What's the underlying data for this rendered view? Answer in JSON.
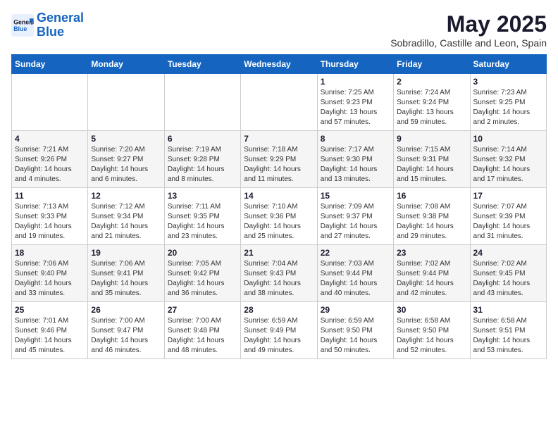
{
  "header": {
    "logo_line1": "General",
    "logo_line2": "Blue",
    "title": "May 2025",
    "subtitle": "Sobradillo, Castille and Leon, Spain"
  },
  "weekdays": [
    "Sunday",
    "Monday",
    "Tuesday",
    "Wednesday",
    "Thursday",
    "Friday",
    "Saturday"
  ],
  "weeks": [
    [
      {
        "day": "",
        "info": ""
      },
      {
        "day": "",
        "info": ""
      },
      {
        "day": "",
        "info": ""
      },
      {
        "day": "",
        "info": ""
      },
      {
        "day": "1",
        "info": "Sunrise: 7:25 AM\nSunset: 9:23 PM\nDaylight: 13 hours\nand 57 minutes."
      },
      {
        "day": "2",
        "info": "Sunrise: 7:24 AM\nSunset: 9:24 PM\nDaylight: 13 hours\nand 59 minutes."
      },
      {
        "day": "3",
        "info": "Sunrise: 7:23 AM\nSunset: 9:25 PM\nDaylight: 14 hours\nand 2 minutes."
      }
    ],
    [
      {
        "day": "4",
        "info": "Sunrise: 7:21 AM\nSunset: 9:26 PM\nDaylight: 14 hours\nand 4 minutes."
      },
      {
        "day": "5",
        "info": "Sunrise: 7:20 AM\nSunset: 9:27 PM\nDaylight: 14 hours\nand 6 minutes."
      },
      {
        "day": "6",
        "info": "Sunrise: 7:19 AM\nSunset: 9:28 PM\nDaylight: 14 hours\nand 8 minutes."
      },
      {
        "day": "7",
        "info": "Sunrise: 7:18 AM\nSunset: 9:29 PM\nDaylight: 14 hours\nand 11 minutes."
      },
      {
        "day": "8",
        "info": "Sunrise: 7:17 AM\nSunset: 9:30 PM\nDaylight: 14 hours\nand 13 minutes."
      },
      {
        "day": "9",
        "info": "Sunrise: 7:15 AM\nSunset: 9:31 PM\nDaylight: 14 hours\nand 15 minutes."
      },
      {
        "day": "10",
        "info": "Sunrise: 7:14 AM\nSunset: 9:32 PM\nDaylight: 14 hours\nand 17 minutes."
      }
    ],
    [
      {
        "day": "11",
        "info": "Sunrise: 7:13 AM\nSunset: 9:33 PM\nDaylight: 14 hours\nand 19 minutes."
      },
      {
        "day": "12",
        "info": "Sunrise: 7:12 AM\nSunset: 9:34 PM\nDaylight: 14 hours\nand 21 minutes."
      },
      {
        "day": "13",
        "info": "Sunrise: 7:11 AM\nSunset: 9:35 PM\nDaylight: 14 hours\nand 23 minutes."
      },
      {
        "day": "14",
        "info": "Sunrise: 7:10 AM\nSunset: 9:36 PM\nDaylight: 14 hours\nand 25 minutes."
      },
      {
        "day": "15",
        "info": "Sunrise: 7:09 AM\nSunset: 9:37 PM\nDaylight: 14 hours\nand 27 minutes."
      },
      {
        "day": "16",
        "info": "Sunrise: 7:08 AM\nSunset: 9:38 PM\nDaylight: 14 hours\nand 29 minutes."
      },
      {
        "day": "17",
        "info": "Sunrise: 7:07 AM\nSunset: 9:39 PM\nDaylight: 14 hours\nand 31 minutes."
      }
    ],
    [
      {
        "day": "18",
        "info": "Sunrise: 7:06 AM\nSunset: 9:40 PM\nDaylight: 14 hours\nand 33 minutes."
      },
      {
        "day": "19",
        "info": "Sunrise: 7:06 AM\nSunset: 9:41 PM\nDaylight: 14 hours\nand 35 minutes."
      },
      {
        "day": "20",
        "info": "Sunrise: 7:05 AM\nSunset: 9:42 PM\nDaylight: 14 hours\nand 36 minutes."
      },
      {
        "day": "21",
        "info": "Sunrise: 7:04 AM\nSunset: 9:43 PM\nDaylight: 14 hours\nand 38 minutes."
      },
      {
        "day": "22",
        "info": "Sunrise: 7:03 AM\nSunset: 9:44 PM\nDaylight: 14 hours\nand 40 minutes."
      },
      {
        "day": "23",
        "info": "Sunrise: 7:02 AM\nSunset: 9:44 PM\nDaylight: 14 hours\nand 42 minutes."
      },
      {
        "day": "24",
        "info": "Sunrise: 7:02 AM\nSunset: 9:45 PM\nDaylight: 14 hours\nand 43 minutes."
      }
    ],
    [
      {
        "day": "25",
        "info": "Sunrise: 7:01 AM\nSunset: 9:46 PM\nDaylight: 14 hours\nand 45 minutes."
      },
      {
        "day": "26",
        "info": "Sunrise: 7:00 AM\nSunset: 9:47 PM\nDaylight: 14 hours\nand 46 minutes."
      },
      {
        "day": "27",
        "info": "Sunrise: 7:00 AM\nSunset: 9:48 PM\nDaylight: 14 hours\nand 48 minutes."
      },
      {
        "day": "28",
        "info": "Sunrise: 6:59 AM\nSunset: 9:49 PM\nDaylight: 14 hours\nand 49 minutes."
      },
      {
        "day": "29",
        "info": "Sunrise: 6:59 AM\nSunset: 9:50 PM\nDaylight: 14 hours\nand 50 minutes."
      },
      {
        "day": "30",
        "info": "Sunrise: 6:58 AM\nSunset: 9:50 PM\nDaylight: 14 hours\nand 52 minutes."
      },
      {
        "day": "31",
        "info": "Sunrise: 6:58 AM\nSunset: 9:51 PM\nDaylight: 14 hours\nand 53 minutes."
      }
    ]
  ]
}
